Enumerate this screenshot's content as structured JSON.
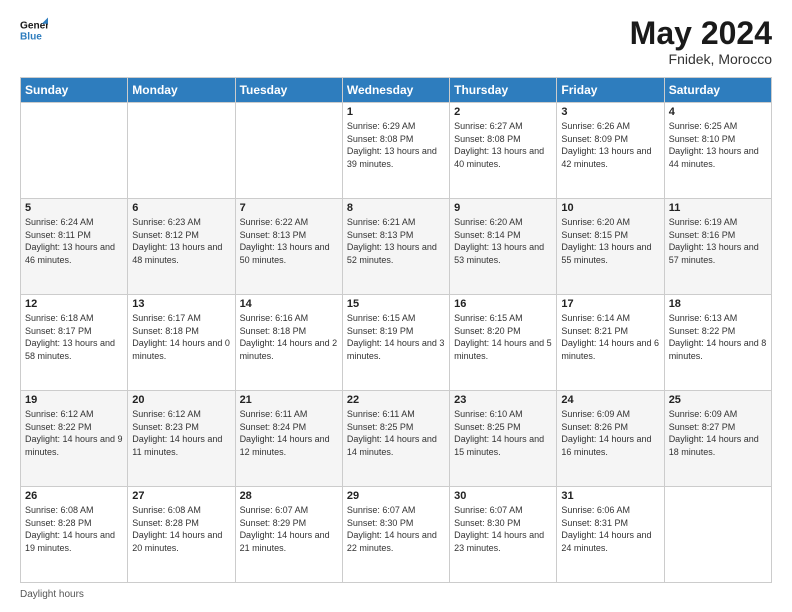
{
  "header": {
    "logo_line1": "General",
    "logo_line2": "Blue",
    "month": "May 2024",
    "location": "Fnidek, Morocco"
  },
  "footer": {
    "label": "Daylight hours"
  },
  "days_of_week": [
    "Sunday",
    "Monday",
    "Tuesday",
    "Wednesday",
    "Thursday",
    "Friday",
    "Saturday"
  ],
  "weeks": [
    [
      {
        "day": "",
        "info": ""
      },
      {
        "day": "",
        "info": ""
      },
      {
        "day": "",
        "info": ""
      },
      {
        "day": "1",
        "info": "Sunrise: 6:29 AM\nSunset: 8:08 PM\nDaylight: 13 hours and 39 minutes."
      },
      {
        "day": "2",
        "info": "Sunrise: 6:27 AM\nSunset: 8:08 PM\nDaylight: 13 hours and 40 minutes."
      },
      {
        "day": "3",
        "info": "Sunrise: 6:26 AM\nSunset: 8:09 PM\nDaylight: 13 hours and 42 minutes."
      },
      {
        "day": "4",
        "info": "Sunrise: 6:25 AM\nSunset: 8:10 PM\nDaylight: 13 hours and 44 minutes."
      }
    ],
    [
      {
        "day": "5",
        "info": "Sunrise: 6:24 AM\nSunset: 8:11 PM\nDaylight: 13 hours and 46 minutes."
      },
      {
        "day": "6",
        "info": "Sunrise: 6:23 AM\nSunset: 8:12 PM\nDaylight: 13 hours and 48 minutes."
      },
      {
        "day": "7",
        "info": "Sunrise: 6:22 AM\nSunset: 8:13 PM\nDaylight: 13 hours and 50 minutes."
      },
      {
        "day": "8",
        "info": "Sunrise: 6:21 AM\nSunset: 8:13 PM\nDaylight: 13 hours and 52 minutes."
      },
      {
        "day": "9",
        "info": "Sunrise: 6:20 AM\nSunset: 8:14 PM\nDaylight: 13 hours and 53 minutes."
      },
      {
        "day": "10",
        "info": "Sunrise: 6:20 AM\nSunset: 8:15 PM\nDaylight: 13 hours and 55 minutes."
      },
      {
        "day": "11",
        "info": "Sunrise: 6:19 AM\nSunset: 8:16 PM\nDaylight: 13 hours and 57 minutes."
      }
    ],
    [
      {
        "day": "12",
        "info": "Sunrise: 6:18 AM\nSunset: 8:17 PM\nDaylight: 13 hours and 58 minutes."
      },
      {
        "day": "13",
        "info": "Sunrise: 6:17 AM\nSunset: 8:18 PM\nDaylight: 14 hours and 0 minutes."
      },
      {
        "day": "14",
        "info": "Sunrise: 6:16 AM\nSunset: 8:18 PM\nDaylight: 14 hours and 2 minutes."
      },
      {
        "day": "15",
        "info": "Sunrise: 6:15 AM\nSunset: 8:19 PM\nDaylight: 14 hours and 3 minutes."
      },
      {
        "day": "16",
        "info": "Sunrise: 6:15 AM\nSunset: 8:20 PM\nDaylight: 14 hours and 5 minutes."
      },
      {
        "day": "17",
        "info": "Sunrise: 6:14 AM\nSunset: 8:21 PM\nDaylight: 14 hours and 6 minutes."
      },
      {
        "day": "18",
        "info": "Sunrise: 6:13 AM\nSunset: 8:22 PM\nDaylight: 14 hours and 8 minutes."
      }
    ],
    [
      {
        "day": "19",
        "info": "Sunrise: 6:12 AM\nSunset: 8:22 PM\nDaylight: 14 hours and 9 minutes."
      },
      {
        "day": "20",
        "info": "Sunrise: 6:12 AM\nSunset: 8:23 PM\nDaylight: 14 hours and 11 minutes."
      },
      {
        "day": "21",
        "info": "Sunrise: 6:11 AM\nSunset: 8:24 PM\nDaylight: 14 hours and 12 minutes."
      },
      {
        "day": "22",
        "info": "Sunrise: 6:11 AM\nSunset: 8:25 PM\nDaylight: 14 hours and 14 minutes."
      },
      {
        "day": "23",
        "info": "Sunrise: 6:10 AM\nSunset: 8:25 PM\nDaylight: 14 hours and 15 minutes."
      },
      {
        "day": "24",
        "info": "Sunrise: 6:09 AM\nSunset: 8:26 PM\nDaylight: 14 hours and 16 minutes."
      },
      {
        "day": "25",
        "info": "Sunrise: 6:09 AM\nSunset: 8:27 PM\nDaylight: 14 hours and 18 minutes."
      }
    ],
    [
      {
        "day": "26",
        "info": "Sunrise: 6:08 AM\nSunset: 8:28 PM\nDaylight: 14 hours and 19 minutes."
      },
      {
        "day": "27",
        "info": "Sunrise: 6:08 AM\nSunset: 8:28 PM\nDaylight: 14 hours and 20 minutes."
      },
      {
        "day": "28",
        "info": "Sunrise: 6:07 AM\nSunset: 8:29 PM\nDaylight: 14 hours and 21 minutes."
      },
      {
        "day": "29",
        "info": "Sunrise: 6:07 AM\nSunset: 8:30 PM\nDaylight: 14 hours and 22 minutes."
      },
      {
        "day": "30",
        "info": "Sunrise: 6:07 AM\nSunset: 8:30 PM\nDaylight: 14 hours and 23 minutes."
      },
      {
        "day": "31",
        "info": "Sunrise: 6:06 AM\nSunset: 8:31 PM\nDaylight: 14 hours and 24 minutes."
      },
      {
        "day": "",
        "info": ""
      }
    ]
  ]
}
